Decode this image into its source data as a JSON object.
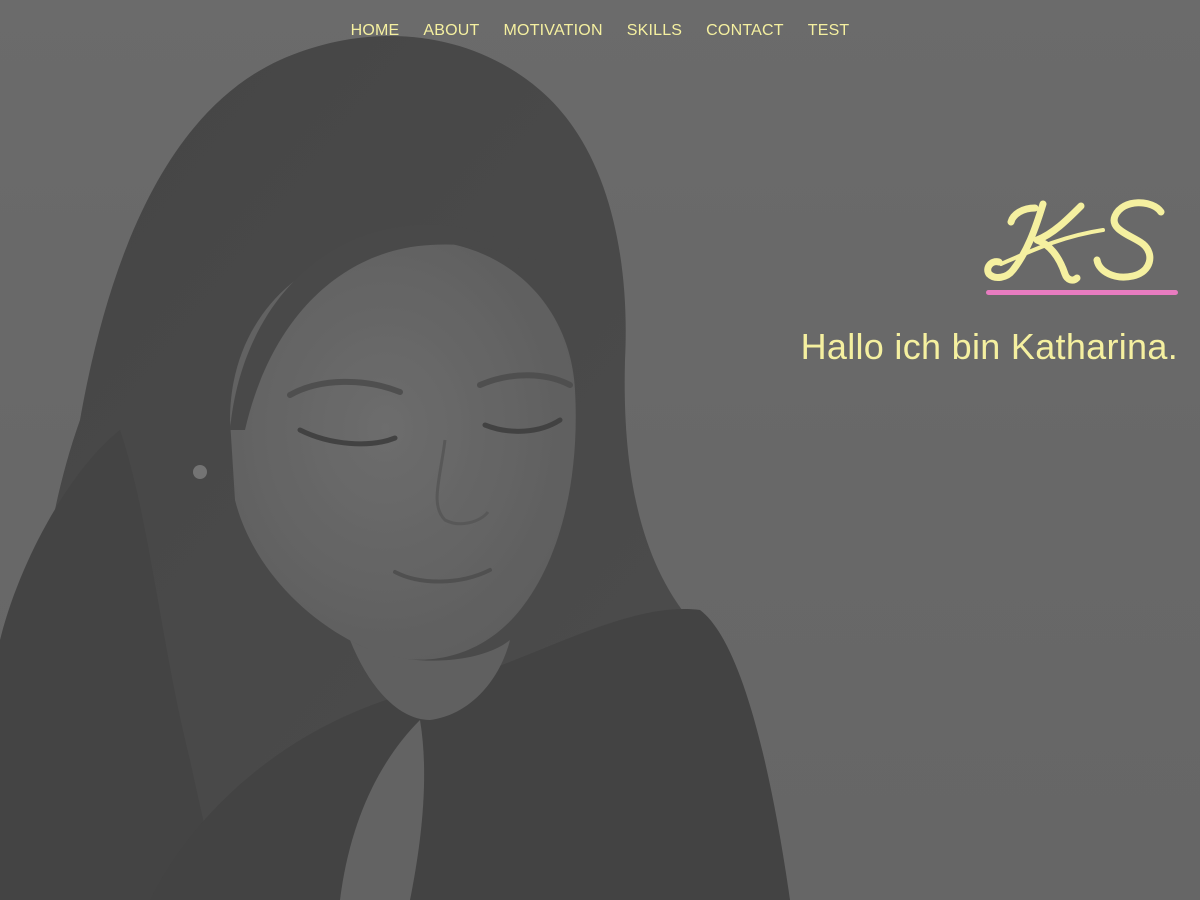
{
  "colors": {
    "background": "#6a6a6a",
    "accent_text": "#f5f0a0",
    "accent_underline": "#e87cc0"
  },
  "nav": {
    "items": [
      {
        "label": "HOME"
      },
      {
        "label": "ABOUT"
      },
      {
        "label": "MOTIVATION"
      },
      {
        "label": "SKILLS"
      },
      {
        "label": "CONTACT"
      },
      {
        "label": "TEST"
      }
    ]
  },
  "hero": {
    "logo_monogram": "KS",
    "greeting": "Hallo ich bin Katharina."
  }
}
